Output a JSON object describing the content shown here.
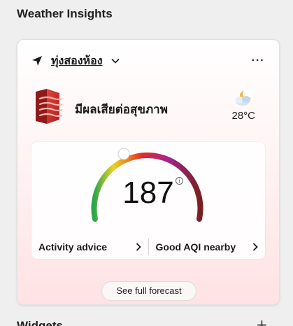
{
  "header": {
    "title": "Weather Insights"
  },
  "card": {
    "location": "ทุ่งสองห้อง",
    "more_label": "···",
    "aqi_status": "มีผลเสียต่อสุขภาพ",
    "temperature": "28°C",
    "aqi_value": "187",
    "info_label": "i",
    "advice": [
      {
        "label": "Activity advice"
      },
      {
        "label": "Good AQI nearby"
      }
    ],
    "forecast_label": "See full forecast"
  },
  "footer": {
    "title": "Widgets",
    "add_label": "+"
  },
  "icons": {
    "location": "navigation-arrow-icon",
    "dropdown": "chevron-down-icon",
    "aqi": "air-quality-building-icon",
    "weather": "partly-cloudy-night-icon",
    "info": "info-icon",
    "arrow": "chevron-right-icon",
    "add": "plus-icon"
  },
  "colors": {
    "aqi_accent": "#c42b2b",
    "gauge_gradient": [
      "#2aa64a",
      "#e8d227",
      "#f08a1c",
      "#e02c2c",
      "#a0268f",
      "#7a1f1f"
    ]
  }
}
